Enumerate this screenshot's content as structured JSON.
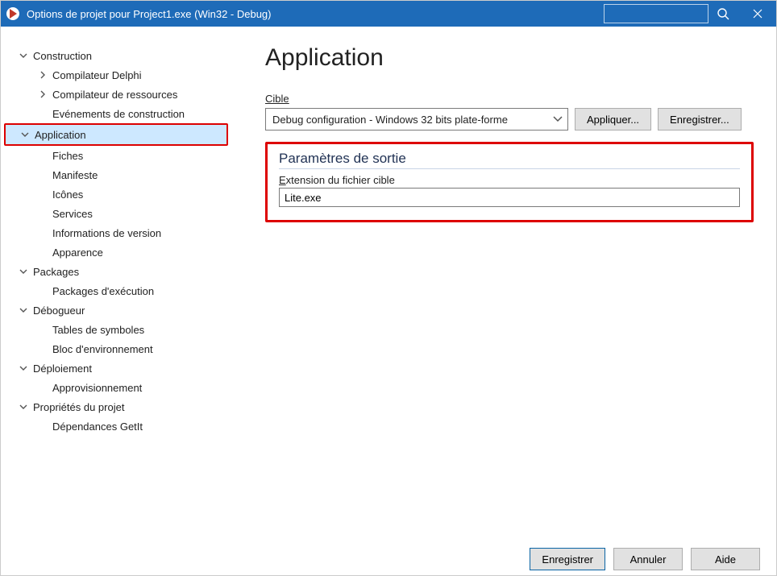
{
  "window": {
    "title": "Options de projet pour Project1.exe  (Win32 - Debug)"
  },
  "sidebar": {
    "items": [
      {
        "label": "Construction",
        "level": 1,
        "expanded": true
      },
      {
        "label": "Compilateur Delphi",
        "level": 2,
        "hasChildren": true
      },
      {
        "label": "Compilateur de ressources",
        "level": 2,
        "hasChildren": true
      },
      {
        "label": "Evénements de construction",
        "level": 2
      },
      {
        "label": "Application",
        "level": 1,
        "expanded": true,
        "selected": true
      },
      {
        "label": "Fiches",
        "level": 2
      },
      {
        "label": "Manifeste",
        "level": 2
      },
      {
        "label": "Icônes",
        "level": 2
      },
      {
        "label": "Services",
        "level": 2
      },
      {
        "label": "Informations de version",
        "level": 2
      },
      {
        "label": "Apparence",
        "level": 2
      },
      {
        "label": "Packages",
        "level": 1,
        "expanded": true
      },
      {
        "label": "Packages d'exécution",
        "level": 2
      },
      {
        "label": "Débogueur",
        "level": 1,
        "expanded": true
      },
      {
        "label": "Tables de symboles",
        "level": 2
      },
      {
        "label": "Bloc d'environnement",
        "level": 2
      },
      {
        "label": "Déploiement",
        "level": 1,
        "expanded": true
      },
      {
        "label": "Approvisionnement",
        "level": 2
      },
      {
        "label": "Propriétés du projet",
        "level": 1,
        "expanded": true
      },
      {
        "label": "Dépendances GetIt",
        "level": 2
      }
    ]
  },
  "main": {
    "heading": "Application",
    "target_label": "Cible",
    "target_combo_value": "Debug configuration - Windows 32 bits plate-forme",
    "apply_label": "Appliquer...",
    "save_top_label": "Enregistrer...",
    "section_title": "Paramètres de sortie",
    "ext_label": "Extension du fichier cible",
    "ext_value": "Lite.exe"
  },
  "footer": {
    "save": "Enregistrer",
    "cancel": "Annuler",
    "help": "Aide"
  }
}
